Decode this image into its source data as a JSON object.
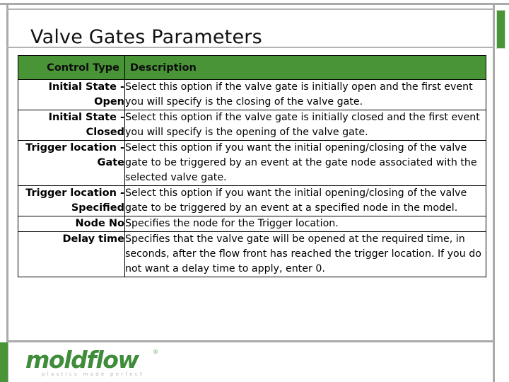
{
  "slide": {
    "title": "Valve Gates Parameters",
    "accent_color": "#4a9438",
    "frame_color": "#aaaaaa"
  },
  "table": {
    "headers": {
      "control_type": "Control Type",
      "description": "Description"
    },
    "rows": [
      {
        "type": "Initial State - Open",
        "description": "Select this option if the valve gate is initially open and the first event you will specify is the closing of the valve gate."
      },
      {
        "type": "Initial State - Closed",
        "description": "Select this option if the valve gate is initially closed and the first event you will specify is the opening of the valve gate."
      },
      {
        "type": "Trigger location - Gate",
        "description": "Select this option if you want the initial opening/closing of the valve gate to be triggered by an event at the gate node associated with the selected valve gate."
      },
      {
        "type": "Trigger location - Specified",
        "description": "Select this option if you want the initial opening/closing of the valve gate to be triggered by an event at a specified node in the model."
      },
      {
        "type": "Node No",
        "description": "Specifies the node for the Trigger location."
      },
      {
        "type": "Delay time",
        "description": "Specifies that the valve gate will be opened at the required time, in seconds, after the flow front has reached the trigger location. If you do not want a delay time to apply, enter 0."
      }
    ]
  },
  "footer": {
    "logo_word": "moldflow",
    "logo_trademark": "®",
    "logo_tagline": "plastics made perfect",
    "logo_color": "#3f8c3a"
  }
}
